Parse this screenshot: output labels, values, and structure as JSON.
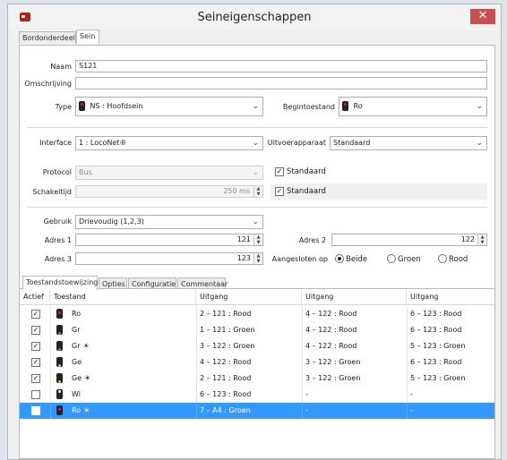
{
  "window": {
    "title": "Seineigenschappen",
    "close_glyph": "✕"
  },
  "tabs": [
    "Bordonderdeel",
    "Sein"
  ],
  "form": {
    "naam": {
      "label": "Naam",
      "value": "S121"
    },
    "omschrijving": {
      "label": "Omschrijving",
      "value": ""
    },
    "type": {
      "label": "Type",
      "value": "NS : Hoofdsein"
    },
    "begintoestand": {
      "label": "Begintoestand",
      "value": "Ro"
    },
    "interface": {
      "label": "Interface",
      "value": "1 : LocoNet®"
    },
    "uitvoerapparaat": {
      "label": "Uitvoerapparaat",
      "value": "Standaard"
    },
    "protocol": {
      "label": "Protocol",
      "value": "Bus"
    },
    "protocol_standaard": {
      "label": "Standaard",
      "checked": true
    },
    "schakeltijd": {
      "label": "Schakeltijd",
      "value": "250 ms"
    },
    "schakeltijd_standaard": {
      "label": "Standaard",
      "checked": true
    },
    "gebruik": {
      "label": "Gebruik",
      "value": "Drievoudig (1,2,3)"
    },
    "adres1": {
      "label": "Adres 1",
      "value": "121"
    },
    "adres2": {
      "label": "Adres 2",
      "value": "122"
    },
    "adres3": {
      "label": "Adres 3",
      "value": "123"
    },
    "aangesloten": {
      "label": "Aangesloten op",
      "options": [
        "Beide",
        "Groen",
        "Rood"
      ],
      "selected": "Beide"
    }
  },
  "subtabs": [
    "Toestandstoewijzing",
    "Opties",
    "Configuratie",
    "Commentaar"
  ],
  "table": {
    "headers": [
      "Actief",
      "Toestand",
      "Uitgang",
      "Uitgang",
      "Uitgang"
    ],
    "rows": [
      {
        "active": true,
        "state": "Ro",
        "flash": false,
        "u1": "2 – 121 : Rood",
        "u2": "4 – 122 : Rood",
        "u3": "6 – 123 : Rood"
      },
      {
        "active": true,
        "state": "Gr",
        "flash": false,
        "u1": "1 – 121 : Groen",
        "u2": "4 – 122 : Rood",
        "u3": "6 – 123 : Rood"
      },
      {
        "active": true,
        "state": "Gr",
        "flash": true,
        "u1": "3 – 122 : Groen",
        "u2": "4 – 122 : Rood",
        "u3": "5 – 123 : Groen"
      },
      {
        "active": true,
        "state": "Ge",
        "flash": false,
        "u1": "4 – 122 : Rood",
        "u2": "3 – 122 : Groen",
        "u3": "6 – 123 : Rood"
      },
      {
        "active": true,
        "state": "Ge",
        "flash": true,
        "u1": "2 – 121 : Rood",
        "u2": "3 – 122 : Groen",
        "u3": "5 – 123 : Groen"
      },
      {
        "active": false,
        "state": "Wi",
        "flash": false,
        "u1": "6 – 123 : Rood",
        "u2": "-",
        "u3": "-"
      },
      {
        "active": false,
        "state": "Ro",
        "flash": true,
        "u1": "7 – A4 : Groen",
        "u2": "-",
        "u3": "-",
        "selected": true
      }
    ]
  },
  "colors": {
    "selection": "#3399ff",
    "close": "#c75050",
    "signal_red": "#dd2222"
  }
}
